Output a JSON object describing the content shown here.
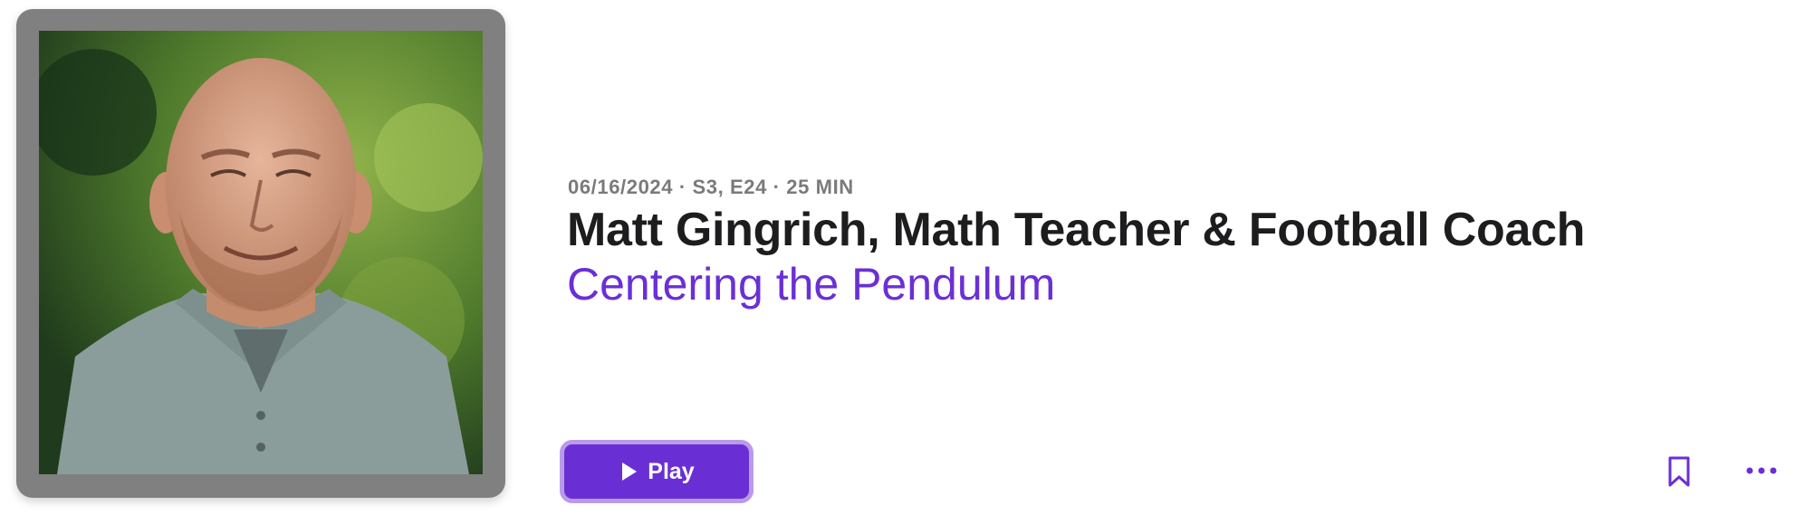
{
  "episode": {
    "meta": "06/16/2024 · S3, E24 · 25 MIN",
    "title": "Matt Gingrich, Math Teacher & Football Coach",
    "show": "Centering the Pendulum"
  },
  "actions": {
    "play_label": "Play",
    "play_icon": "play-icon",
    "bookmark_icon": "bookmark-icon",
    "more_icon": "ellipsis-icon"
  },
  "colors": {
    "accent": "#6a2fd4",
    "accent_border": "#b99be8",
    "title": "#1d1d1f",
    "meta": "#7a7a7a",
    "artwork_frame": "#808080"
  }
}
